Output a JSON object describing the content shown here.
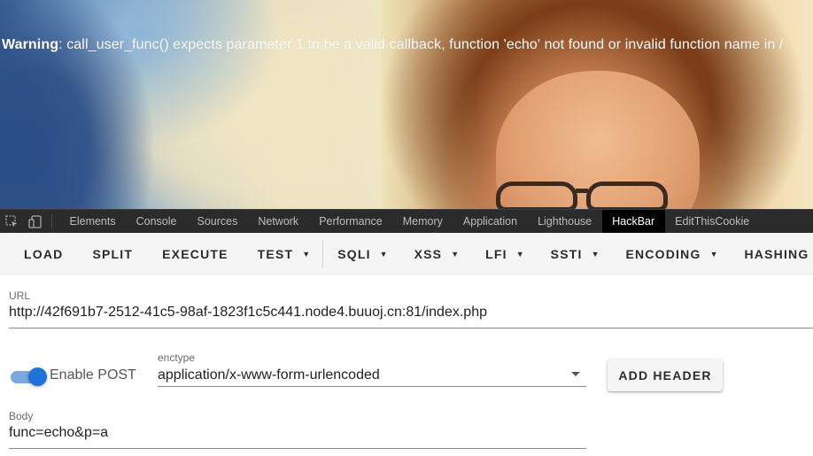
{
  "page": {
    "warning_label": "Warning",
    "warning_message": ": call_user_func() expects parameter 1 to be a valid callback, function 'echo' not found or invalid function name in /"
  },
  "devtools": {
    "icons": [
      "inspect-element-icon",
      "device-toolbar-icon"
    ],
    "tabs": [
      {
        "label": "Elements"
      },
      {
        "label": "Console"
      },
      {
        "label": "Sources"
      },
      {
        "label": "Network"
      },
      {
        "label": "Performance"
      },
      {
        "label": "Memory"
      },
      {
        "label": "Application"
      },
      {
        "label": "Lighthouse"
      },
      {
        "label": "HackBar",
        "active": true
      },
      {
        "label": "EditThisCookie"
      }
    ]
  },
  "hackbar": {
    "buttons": {
      "load": "LOAD",
      "split": "SPLIT",
      "execute": "EXECUTE",
      "test": "TEST",
      "sqli": "SQLI",
      "xss": "XSS",
      "lfi": "LFI",
      "ssti": "SSTI",
      "encoding": "ENCODING",
      "hashing": "HASHING"
    },
    "dropdown_caret": "▼",
    "url": {
      "label": "URL",
      "value": "http://42f691b7-2512-41c5-98af-1823f1c5c441.node4.buuoj.cn:81/index.php"
    },
    "enable_post": {
      "label": "Enable POST",
      "checked": true
    },
    "enctype": {
      "label": "enctype",
      "value": "application/x-www-form-urlencoded"
    },
    "add_header_label": "ADD HEADER",
    "body": {
      "label": "Body",
      "value": "func=echo&p=a"
    }
  },
  "colors": {
    "devtools_bg": "#2b2b2b",
    "active_tab_bg": "#000000",
    "toolbar_bg": "#f5f5f5",
    "toggle_accent": "#1e73d8"
  }
}
